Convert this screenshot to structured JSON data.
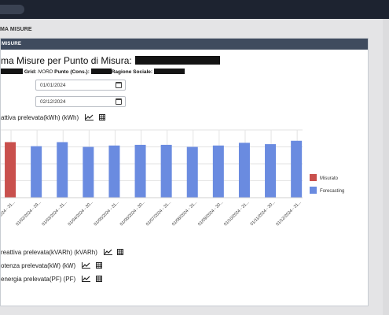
{
  "crumb": "MA MISURE",
  "panel_header": "MISURE",
  "page_title": "ma Misure per Punto di Misura:",
  "info": {
    "grid_label": "Grid:",
    "grid_value": "NORD",
    "point_label": "Punto (Cons.):",
    "company_label": "Ragione Sociale:"
  },
  "date_from": "01/01/2024",
  "date_to": "02/12/2024",
  "sections": {
    "energy_active": "attiva prelevata(kWh) (kWh)",
    "energy_reactive": "reattiva prelevata(kVARh) (kVARh)",
    "power": "otenza prelevata(kW) (kW)",
    "power_factor": "energia prelevata(PF) (PF)"
  },
  "colors": {
    "measured": "#c9504d",
    "forecast": "#6a8be0",
    "grid": "#e3e3e3"
  },
  "chart_data": {
    "type": "bar",
    "categories": [
      "01/01/2024 - 31...",
      "01/02/2024 - 29...",
      "01/03/2024 - 31...",
      "01/04/2024 - 30...",
      "01/05/2024 - 31...",
      "01/06/2024 - 30...",
      "01/07/2024 - 31...",
      "01/08/2024 - 31...",
      "01/09/2024 - 30...",
      "01/10/2024 - 31...",
      "01/11/2024 - 30...",
      "01/12/2024 - 31..."
    ],
    "series": [
      {
        "name": "Misurato",
        "values": [
          82,
          null,
          null,
          null,
          null,
          null,
          null,
          null,
          null,
          null,
          null,
          null
        ]
      },
      {
        "name": "Forecasting",
        "values": [
          null,
          76,
          82,
          75,
          77,
          78,
          78,
          75,
          77,
          81,
          79,
          84
        ]
      }
    ],
    "ylim": [
      0,
      100
    ],
    "grid": true,
    "legend": "right"
  }
}
